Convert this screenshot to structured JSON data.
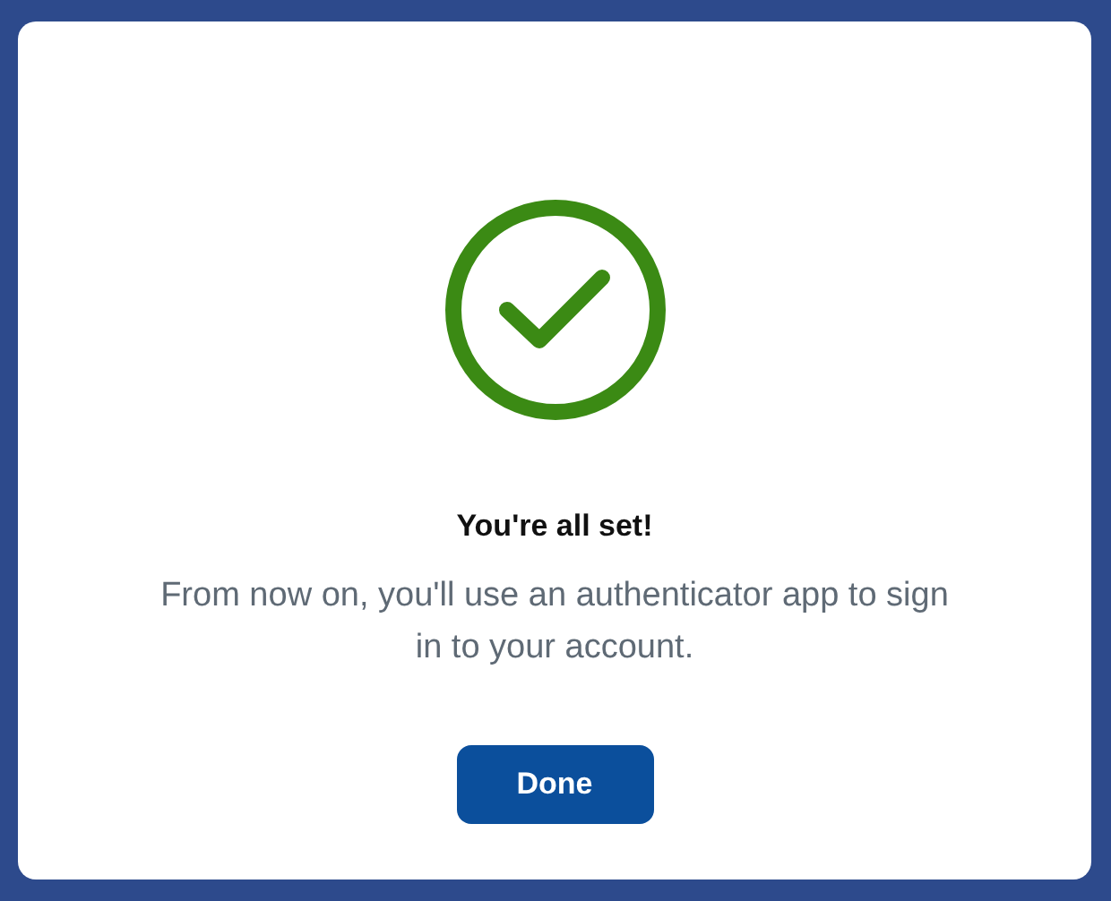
{
  "dialog": {
    "title": "You're all set!",
    "message": "From now on, you'll use an authenticator app to sign in to your account.",
    "button": "Done"
  }
}
